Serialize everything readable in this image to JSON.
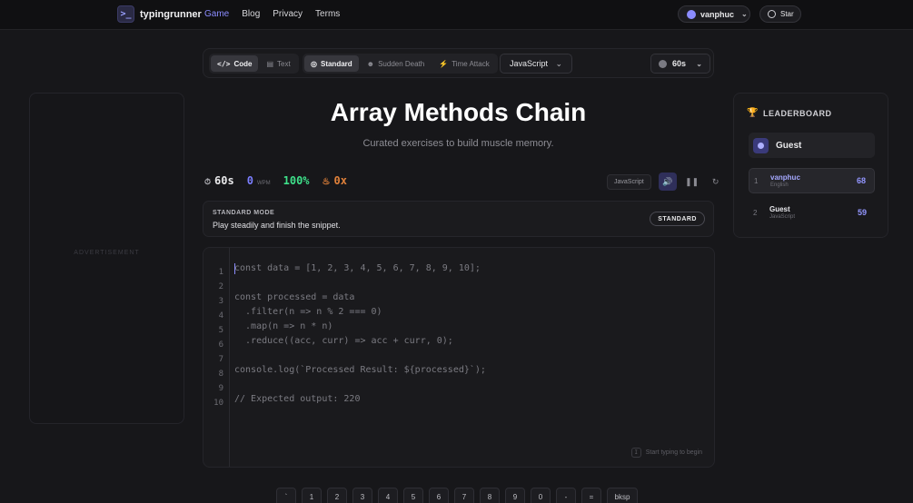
{
  "brand": {
    "name": "typingrunner",
    "logo_glyph": ">_"
  },
  "nav": {
    "links": [
      "Game",
      "Blog",
      "Privacy",
      "Terms"
    ],
    "active": "Game"
  },
  "user": {
    "name": "vanphuc"
  },
  "github": {
    "label": "Star"
  },
  "toolbar": {
    "content_types": [
      {
        "label": "Code",
        "active": true
      },
      {
        "label": "Text",
        "active": false
      }
    ],
    "modes": [
      {
        "label": "Standard",
        "active": true
      },
      {
        "label": "Sudden Death",
        "active": false
      },
      {
        "label": "Time Attack",
        "active": false
      }
    ],
    "language": "JavaScript",
    "duration": "60s"
  },
  "ad": {
    "label": "ADVERTISEMENT"
  },
  "exercise": {
    "title": "Array Methods Chain",
    "subtitle": "Curated exercises to build muscle memory."
  },
  "stats": {
    "time": "60s",
    "wpm": "0",
    "wpm_label": "WPM",
    "accuracy": "100%",
    "combo": "0x",
    "language_badge": "JavaScript"
  },
  "mode_banner": {
    "label": "STANDARD MODE",
    "description": "Play steadily and finish the snippet.",
    "tag": "STANDARD"
  },
  "editor": {
    "lines": [
      "const data = [1, 2, 3, 4, 5, 6, 7, 8, 9, 10];",
      "",
      "const processed = data",
      "  .filter(n => n % 2 === 0)",
      "  .map(n => n * n)",
      "  .reduce((acc, curr) => acc + curr, 0);",
      "",
      "console.log(`Processed Result: ${processed}`);",
      "",
      "// Expected output: 220"
    ],
    "line_numbers": [
      "1",
      "2",
      "3",
      "4",
      "5",
      "6",
      "7",
      "8",
      "9",
      "10"
    ],
    "hint_key": "I",
    "hint": "Start typing to begin"
  },
  "leaderboard": {
    "title": "LEADERBOARD",
    "current": "Guest",
    "rows": [
      {
        "rank": "1",
        "name": "vanphuc",
        "lang": "English",
        "score": "68"
      },
      {
        "rank": "2",
        "name": "Guest",
        "lang": "JavaScript",
        "score": "59"
      }
    ]
  },
  "keyboard": {
    "keys": [
      "`",
      "1",
      "2",
      "3",
      "4",
      "5",
      "6",
      "7",
      "8",
      "9",
      "0",
      "-",
      "=",
      "bksp"
    ]
  },
  "colors": {
    "accent": "#8b8cff",
    "accuracy": "#3ee08a",
    "combo": "#e0813a",
    "trophy": "#f0c23a"
  }
}
